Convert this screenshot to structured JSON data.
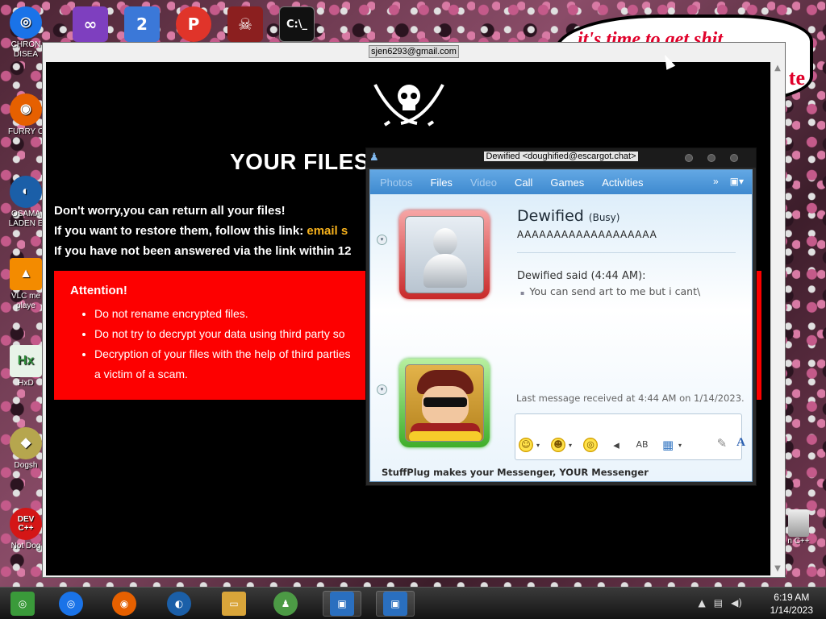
{
  "desktop": {
    "icons_left": [
      {
        "label": "CHRON\nDISEA",
        "color": "#1a73e8",
        "glyph": "◎"
      },
      {
        "label": "FURRY C",
        "color": "#e66000",
        "glyph": "◉"
      },
      {
        "label": "OSAMA\nLADEN E",
        "color": "#1b5fa8",
        "glyph": "◐"
      },
      {
        "label": "VLC me\nplaye",
        "color": "#f38b00",
        "glyph": "▲"
      },
      {
        "label": "HxD",
        "color": "#2f8d3a",
        "glyph": "Hx"
      },
      {
        "label": "Dogsh",
        "color": "#b6a64e",
        "glyph": "◆"
      },
      {
        "label": "Not Dog",
        "color": "#d41616",
        "glyph": "DEV C++"
      }
    ],
    "icons_top": [
      {
        "name": "chrome-icon",
        "color": "#1a73e8",
        "glyph": "◎"
      },
      {
        "name": "visual-studio-icon",
        "color": "#7e3fbf",
        "glyph": "∞"
      },
      {
        "name": "two-icon",
        "color": "#3b78d8",
        "glyph": "2"
      },
      {
        "name": "p-icon",
        "color": "#e0342a",
        "glyph": "P"
      },
      {
        "name": "red-sigil-icon",
        "color": "#8b1f1f",
        "glyph": "☠"
      },
      {
        "name": "cmd-icon",
        "color": "#111111",
        "glyph": "C:\\_"
      }
    ],
    "speech_text": "it's time to get shit",
    "speech_fragment": "te",
    "recycle_label": "n C++"
  },
  "ransom_window": {
    "title": "sjen6293@gmail.com",
    "heading": "YOUR FILES",
    "line1": "Don't worry,you can return all your files!",
    "line2_prefix": "If you want to restore them, follow this link: ",
    "line2_link": "email s",
    "line3": "If you have not been answered via the link within 12",
    "attention": {
      "title": "Attention!",
      "items": [
        "Do not rename encrypted files.",
        "Do not try to decrypt your data using third party so",
        "Decryption of your files with the help of third parties",
        "a victim of a scam."
      ]
    }
  },
  "messenger": {
    "title": "Dewified <doughified@escargot.chat>",
    "toolbar": {
      "photos": "Photos",
      "files": "Files",
      "video": "Video",
      "call": "Call",
      "games": "Games",
      "activities": "Activities",
      "more": "»"
    },
    "contact_name": "Dewified",
    "contact_status": "(Busy)",
    "contact_psm": "AAAAAAAAAAAAAAAAAAA",
    "said_header": "Dewified said (4:44 AM):",
    "said_message": "You can send art to me but i cant\\",
    "last_message": "Last message received at 4:44 AM on 1/14/2023.",
    "footer": "StuffPlug makes your Messenger, YOUR Messenger"
  },
  "taskbar": {
    "items": [
      {
        "name": "taskbar-chromium-icon",
        "color": "#3a9a3a"
      },
      {
        "name": "taskbar-chrome-icon",
        "color": "#1a73e8"
      },
      {
        "name": "taskbar-firefox-icon",
        "color": "#e66000"
      },
      {
        "name": "taskbar-obama-icon",
        "color": "#1b5fa8"
      },
      {
        "name": "taskbar-explorer-icon",
        "color": "#d9a53a"
      },
      {
        "name": "taskbar-messenger-icon",
        "color": "#4c9a45"
      },
      {
        "name": "taskbar-setup-icon-1",
        "color": "#2a6fbf"
      },
      {
        "name": "taskbar-setup-icon-2",
        "color": "#2a6fbf"
      }
    ],
    "time": "6:19 AM",
    "date": "1/14/2023"
  }
}
